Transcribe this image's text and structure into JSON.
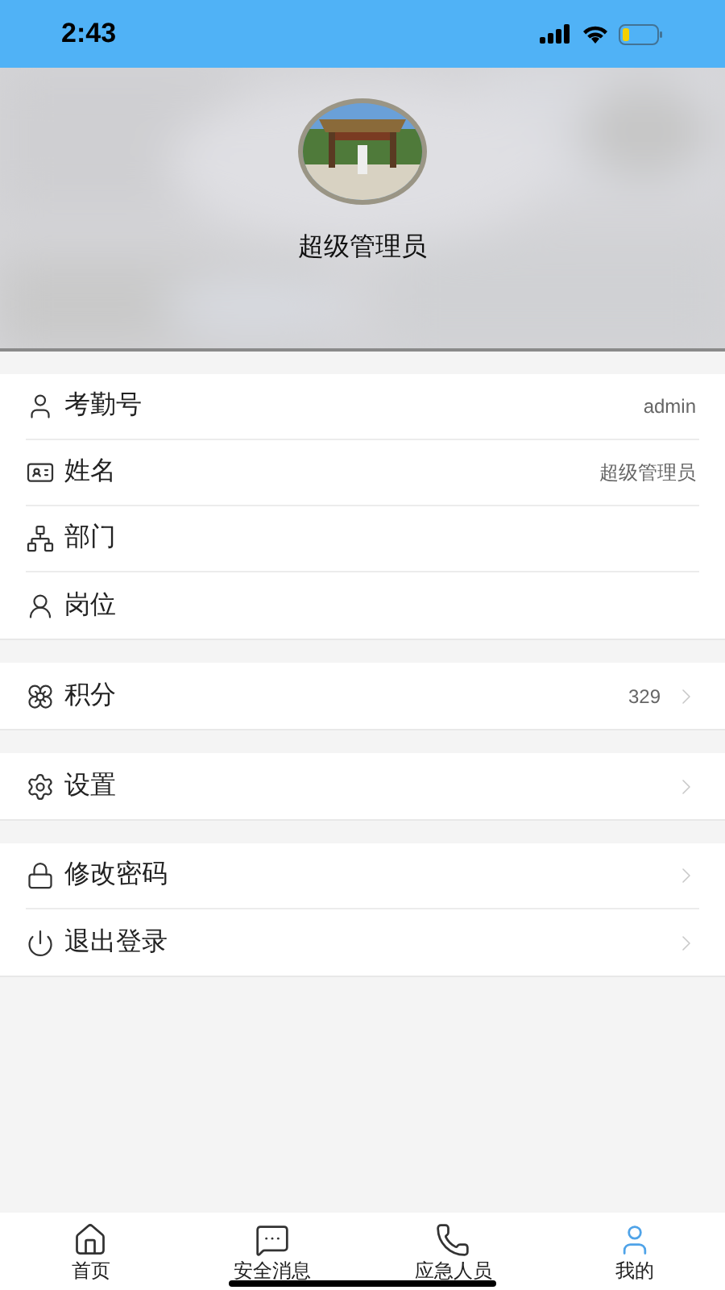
{
  "status_bar": {
    "time": "2:43"
  },
  "profile": {
    "name": "超级管理员"
  },
  "sections": [
    {
      "rows": [
        {
          "kind": "user",
          "label": "考勤号",
          "value": "admin",
          "chevron": false
        },
        {
          "kind": "id-card",
          "label": "姓名",
          "value": "超级管理员",
          "chevron": false
        },
        {
          "kind": "org",
          "label": "部门",
          "chevron": false
        },
        {
          "kind": "post",
          "label": "岗位",
          "chevron": false
        }
      ]
    },
    {
      "rows": [
        {
          "kind": "flower",
          "label": "积分",
          "value": "329",
          "chevron": true
        }
      ]
    },
    {
      "rows": [
        {
          "kind": "gear",
          "label": "设置",
          "chevron": true
        }
      ]
    },
    {
      "rows": [
        {
          "kind": "lock",
          "label": "修改密码",
          "chevron": true
        },
        {
          "kind": "power",
          "label": "退出登录",
          "chevron": true
        }
      ]
    }
  ],
  "tab_bar": [
    {
      "kind": "home",
      "label": "首页",
      "selected": false
    },
    {
      "kind": "message",
      "label": "安全消息",
      "selected": false
    },
    {
      "kind": "phone",
      "label": "应急人员",
      "selected": false
    },
    {
      "kind": "user",
      "label": "我的",
      "selected": true
    }
  ]
}
